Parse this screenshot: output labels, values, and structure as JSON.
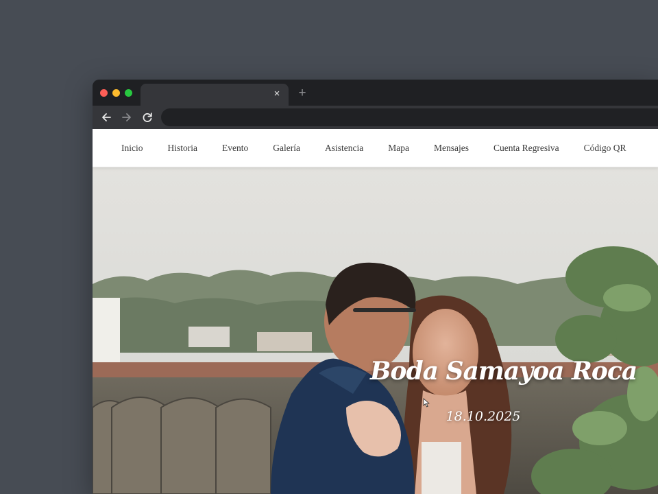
{
  "browser": {
    "tab": {
      "close_glyph": "×",
      "close_icon": "close-icon"
    },
    "new_tab_glyph": "+",
    "controls": {
      "back_icon": "arrow-left-icon",
      "forward_icon": "arrow-right-icon",
      "reload_icon": "reload-icon"
    },
    "traffic_lights": {
      "close": "#ff5f57",
      "minimize": "#febc2e",
      "maximize": "#28c840"
    }
  },
  "navbar": {
    "links": [
      {
        "label": "Inicio"
      },
      {
        "label": "Historia"
      },
      {
        "label": "Evento"
      },
      {
        "label": "Galería"
      },
      {
        "label": "Asistencia"
      },
      {
        "label": "Mapa"
      },
      {
        "label": "Mensajes"
      },
      {
        "label": "Cuenta Regresiva"
      },
      {
        "label": "Código QR"
      }
    ]
  },
  "hero": {
    "title": "Boda Samayoa Roca",
    "date": "18.10.2025"
  },
  "colors": {
    "desktop": "#474c54",
    "browser_frame": "#1f2023",
    "tab": "#35363a",
    "nav_text": "#3a3a3a",
    "hero_text": "#ffffff"
  }
}
